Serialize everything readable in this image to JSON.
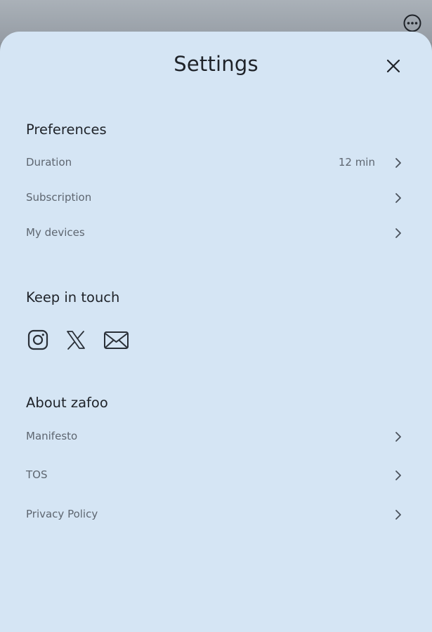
{
  "header": {
    "title": "Settings",
    "more_icon": "more-horizontal-icon",
    "close_icon": "close-icon"
  },
  "preferences": {
    "heading": "Preferences",
    "items": [
      {
        "label": "Duration",
        "value": "12 min"
      },
      {
        "label": "Subscription",
        "value": ""
      },
      {
        "label": "My devices",
        "value": ""
      }
    ]
  },
  "keep_in_touch": {
    "heading": "Keep in touch",
    "icons": [
      "instagram-icon",
      "x-icon",
      "mail-icon"
    ]
  },
  "about": {
    "heading": "About zafoo",
    "items": [
      {
        "label": "Manifesto"
      },
      {
        "label": "TOS"
      },
      {
        "label": "Privacy Policy"
      }
    ]
  },
  "colors": {
    "sheet_background": "#d5e5f4",
    "backdrop": "#8e959c",
    "heading_text": "#1f2329",
    "secondary_text": "#5e6670"
  }
}
